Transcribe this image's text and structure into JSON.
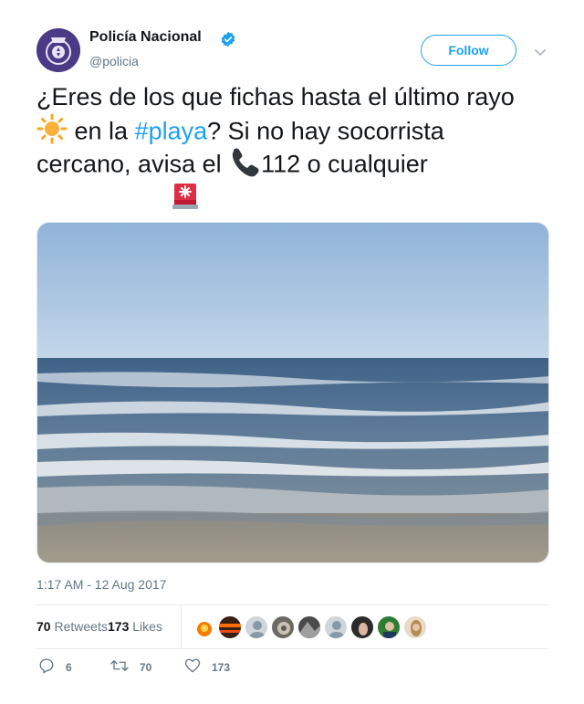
{
  "header": {
    "display_name": "Policía Nacional",
    "handle": "@policia",
    "verified_icon": "verified-badge-icon",
    "follow_label": "Follow",
    "menu_icon": "chevron-down-icon"
  },
  "tweet": {
    "line1": "¿Eres de los que fichas hasta el último rayo",
    "line2_after_emoji": " en la ",
    "hashtag": "#playa",
    "line2_end": "? Si no hay socorrista",
    "line3_start": "cercano, avisa el ",
    "line3_end": "112 o cualquier",
    "line4": "",
    "emojis": [
      "sun-emoji",
      "telephone-receiver-emoji",
      "police-light-emoji"
    ]
  },
  "meta": {
    "timestamp": "1:17 AM - 12 Aug 2017"
  },
  "stats": {
    "retweets_count": "70",
    "retweets_label": "Retweets",
    "likes_count": "173",
    "likes_label": "Likes"
  },
  "actions": {
    "reply_count": "6",
    "retweet_count": "70",
    "like_count": "173"
  },
  "colors": {
    "accent": "#1da1f2",
    "text": "#14171a",
    "secondary": "#657786",
    "border": "#e6ecf0"
  }
}
